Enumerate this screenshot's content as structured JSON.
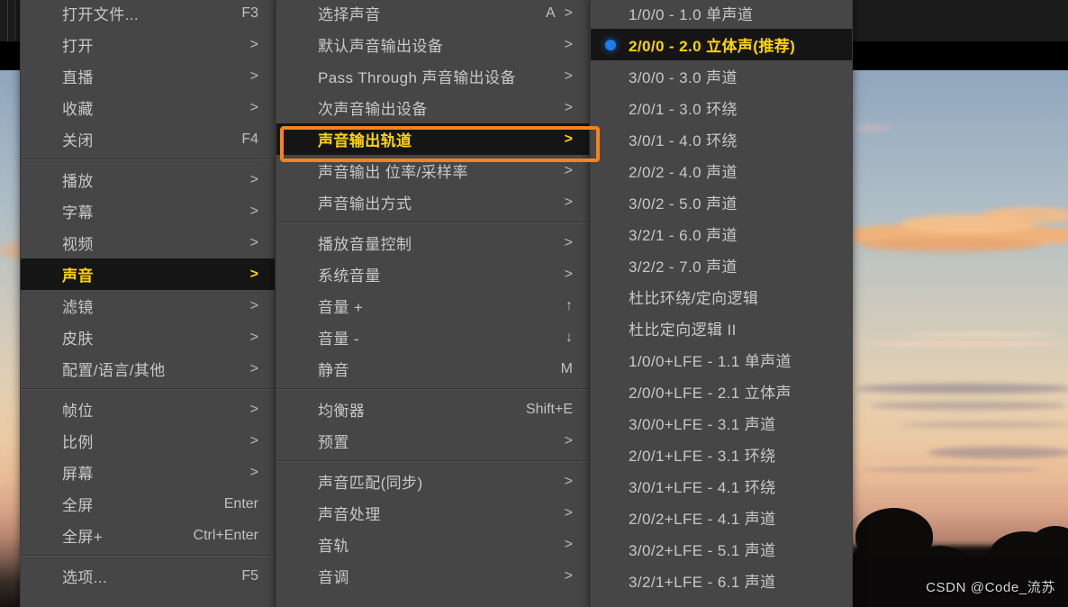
{
  "app": {
    "watermark": "CSDN @Code_流苏"
  },
  "menu1": {
    "name": "主菜单",
    "groups": [
      {
        "items": [
          {
            "label": "打开文件...",
            "accel": "F3",
            "arrow": ""
          },
          {
            "label": "打开",
            "accel": "",
            "arrow": ">"
          },
          {
            "label": "直播",
            "accel": "",
            "arrow": ">"
          },
          {
            "label": "收藏",
            "accel": "",
            "arrow": ">"
          },
          {
            "label": "关闭",
            "accel": "F4",
            "arrow": ""
          }
        ]
      },
      {
        "items": [
          {
            "label": "播放",
            "accel": "",
            "arrow": ">"
          },
          {
            "label": "字幕",
            "accel": "",
            "arrow": ">"
          },
          {
            "label": "视频",
            "accel": "",
            "arrow": ">"
          },
          {
            "label": "声音",
            "accel": "",
            "arrow": ">",
            "selected": true
          },
          {
            "label": "滤镜",
            "accel": "",
            "arrow": ">"
          },
          {
            "label": "皮肤",
            "accel": "",
            "arrow": ">"
          },
          {
            "label": "配置/语言/其他",
            "accel": "",
            "arrow": ">"
          }
        ]
      },
      {
        "items": [
          {
            "label": "帧位",
            "accel": "",
            "arrow": ">"
          },
          {
            "label": "比例",
            "accel": "",
            "arrow": ">"
          },
          {
            "label": "屏幕",
            "accel": "",
            "arrow": ">"
          },
          {
            "label": "全屏",
            "accel": "Enter",
            "arrow": ""
          },
          {
            "label": "全屏+",
            "accel": "Ctrl+Enter",
            "arrow": ""
          }
        ]
      },
      {
        "items": [
          {
            "label": "选项...",
            "accel": "F5",
            "arrow": ""
          }
        ]
      }
    ]
  },
  "menu2": {
    "name": "声音",
    "groups": [
      {
        "items": [
          {
            "label": "选择声音",
            "accel": "A",
            "arrow": ">"
          },
          {
            "label": "默认声音输出设备",
            "accel": "",
            "arrow": ">"
          },
          {
            "label": "Pass Through 声音输出设备",
            "accel": "",
            "arrow": ">"
          },
          {
            "label": "次声音输出设备",
            "accel": "",
            "arrow": ">"
          },
          {
            "label": "声音输出轨道",
            "accel": "",
            "arrow": ">",
            "selected": true,
            "annotated": true
          },
          {
            "label": "声音输出 位率/采样率",
            "accel": "",
            "arrow": ">"
          },
          {
            "label": "声音输出方式",
            "accel": "",
            "arrow": ">"
          }
        ]
      },
      {
        "items": [
          {
            "label": "播放音量控制",
            "accel": "",
            "arrow": ">"
          },
          {
            "label": "系统音量",
            "accel": "",
            "arrow": ">"
          },
          {
            "label": "音量 +",
            "accel": "↑",
            "arrow": ""
          },
          {
            "label": "音量 -",
            "accel": "↓",
            "arrow": ""
          },
          {
            "label": "静音",
            "accel": "M",
            "arrow": ""
          }
        ]
      },
      {
        "items": [
          {
            "label": "均衡器",
            "accel": "Shift+E",
            "arrow": ""
          },
          {
            "label": "预置",
            "accel": "",
            "arrow": ">"
          }
        ]
      },
      {
        "items": [
          {
            "label": "声音匹配(同步)",
            "accel": "",
            "arrow": ">"
          },
          {
            "label": "声音处理",
            "accel": "",
            "arrow": ">"
          },
          {
            "label": "音轨",
            "accel": "",
            "arrow": ">"
          },
          {
            "label": "音调",
            "accel": "",
            "arrow": ">"
          }
        ]
      }
    ]
  },
  "menu3": {
    "name": "声音输出轨道",
    "groups": [
      {
        "items": [
          {
            "label": "1/0/0 - 1.0 单声道"
          },
          {
            "label": "2/0/0 - 2.0 立体声(推荐)",
            "selected": true,
            "checked": true
          },
          {
            "label": "3/0/0 - 3.0 声道"
          },
          {
            "label": "2/0/1 - 3.0 环绕"
          },
          {
            "label": "3/0/1 - 4.0 环绕"
          },
          {
            "label": "2/0/2 - 4.0 声道"
          },
          {
            "label": "3/0/2 - 5.0 声道"
          },
          {
            "label": "3/2/1 - 6.0 声道"
          },
          {
            "label": "3/2/2 - 7.0 声道"
          },
          {
            "label": "杜比环绕/定向逻辑"
          },
          {
            "label": "杜比定向逻辑 II"
          },
          {
            "label": "1/0/0+LFE - 1.1 单声道"
          },
          {
            "label": "2/0/0+LFE - 2.1 立体声"
          },
          {
            "label": "3/0/0+LFE - 3.1 声道"
          },
          {
            "label": "2/0/1+LFE - 3.1 环绕"
          },
          {
            "label": "3/0/1+LFE - 4.1 环绕"
          },
          {
            "label": "2/0/2+LFE - 4.1 声道"
          },
          {
            "label": "3/0/2+LFE - 5.1 声道"
          },
          {
            "label": "3/2/1+LFE - 6.1 声道"
          }
        ]
      }
    ]
  },
  "colors": {
    "menu_bg": "#464646",
    "menu_text": "#c8c8c8",
    "highlight_bg": "#151515",
    "highlight_text": "#ffd400",
    "annotation": "#f58220",
    "radio_dot": "#1b7ef0"
  }
}
